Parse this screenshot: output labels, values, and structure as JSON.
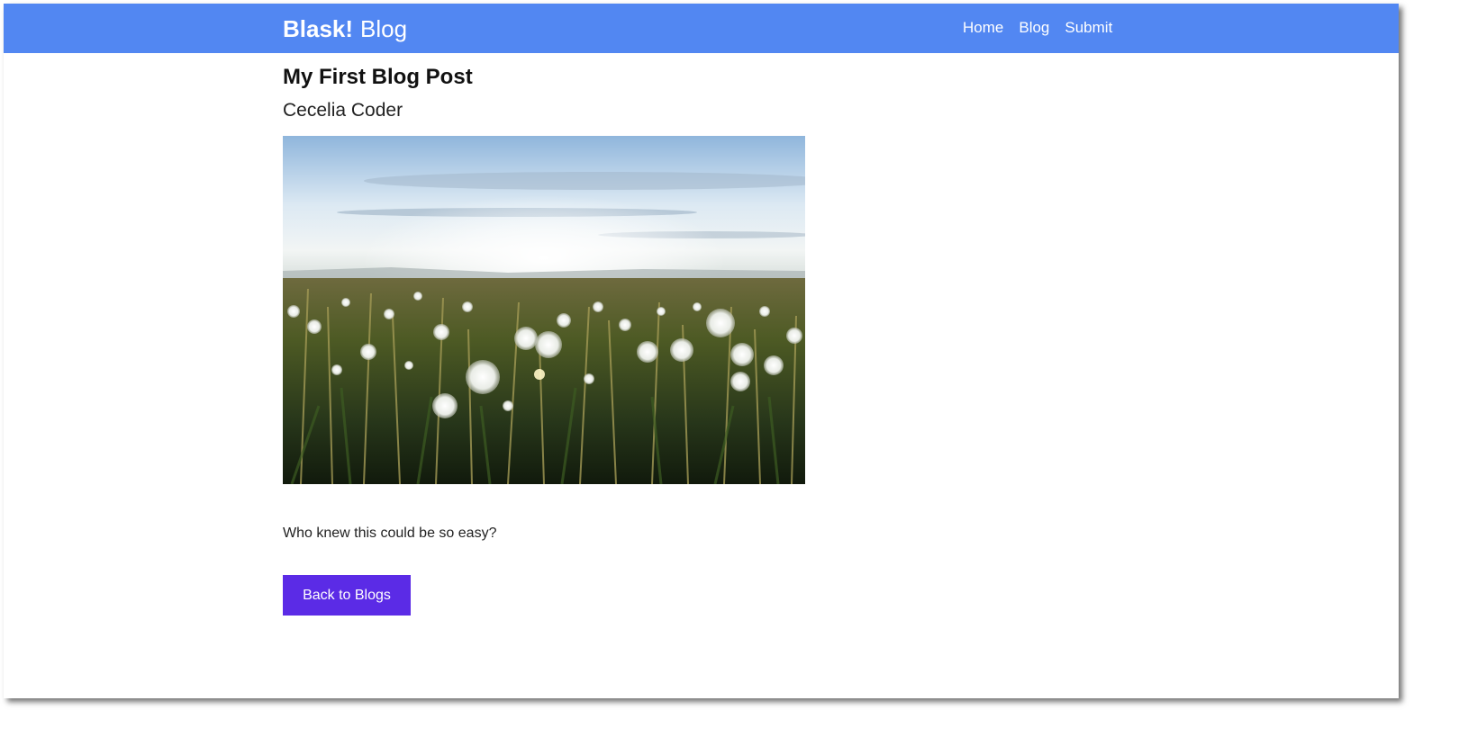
{
  "navbar": {
    "brand_strong": "Blask!",
    "brand_light": "Blog",
    "links": [
      {
        "label": "Home"
      },
      {
        "label": "Blog"
      },
      {
        "label": "Submit"
      }
    ],
    "background_color": "#5287f2"
  },
  "post": {
    "title": "My First Blog Post",
    "author": "Cecelia Coder",
    "image_subject": "dandelion-field-photo",
    "body": "Who knew this could be so easy?"
  },
  "actions": {
    "back_label": "Back to Blogs",
    "button_color": "#5b2be6"
  }
}
